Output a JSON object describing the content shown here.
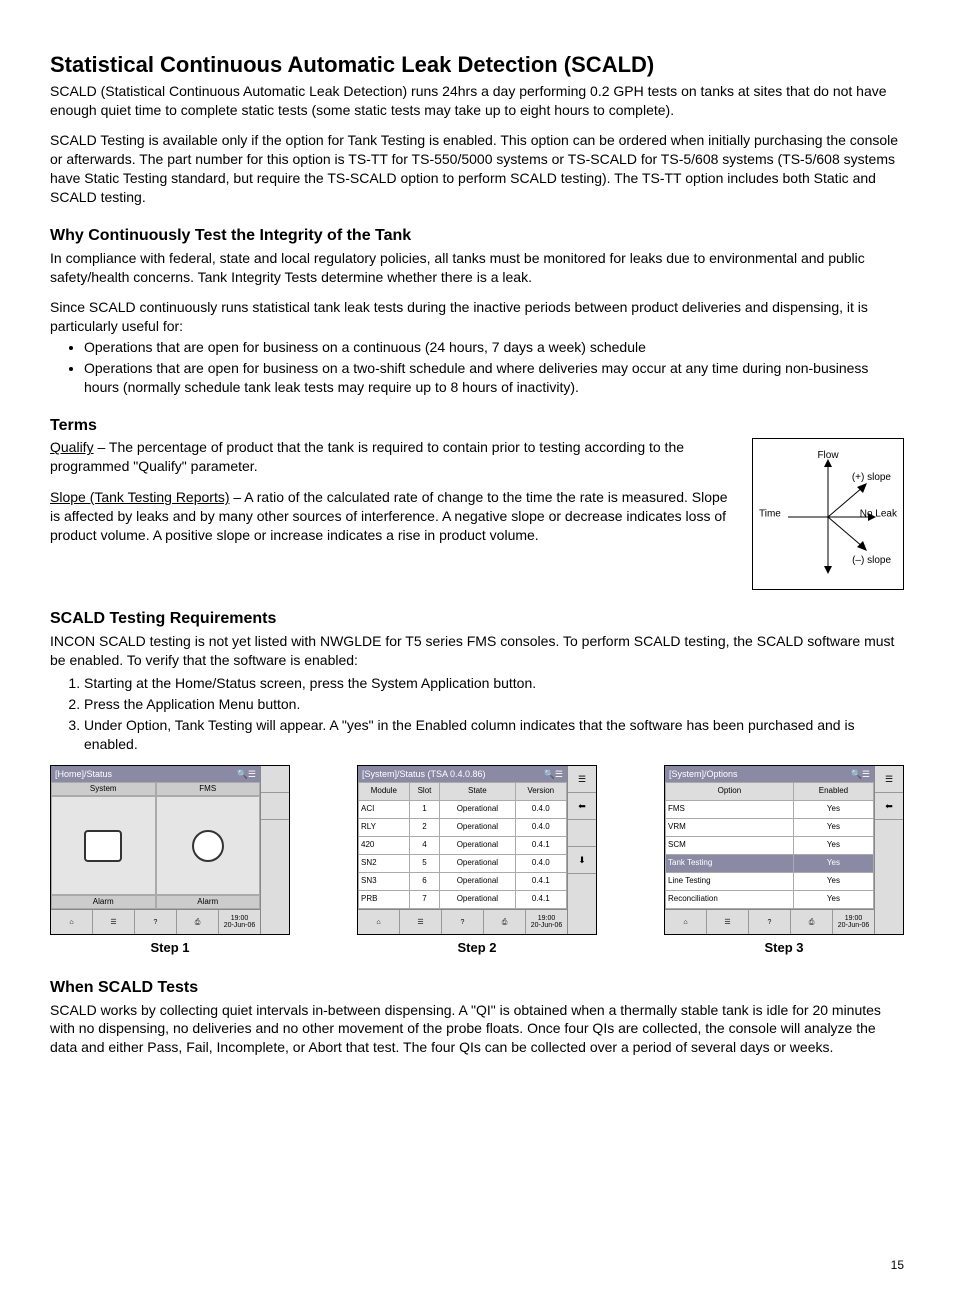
{
  "title": "Statistical Continuous Automatic Leak Detection (SCALD)",
  "intro1": "SCALD (Statistical Continuous Automatic Leak Detection) runs 24hrs a day performing 0.2 GPH tests on tanks at sites that do not have enough quiet time to complete static tests (some static tests may take up to eight hours to complete).",
  "intro2": "SCALD Testing is available only if the option for Tank Testing is enabled. This option can be ordered when initially purchasing the console or afterwards. The part number for this option is TS-TT for TS-550/5000 systems or TS-SCALD for TS-5/608 systems (TS-5/608 systems have Static Testing standard, but require the TS-SCALD option to perform SCALD testing). The TS-TT option includes both Static and SCALD testing.",
  "why_h": "Why Continuously Test the Integrity of the Tank",
  "why_p1": "In compliance with federal, state and local regulatory policies, all tanks must be monitored for leaks due to environmental and public safety/health concerns. Tank Integrity Tests determine whether there is a leak.",
  "why_p2": "Since SCALD continuously runs statistical tank leak tests during the inactive periods between product deliveries and dispensing, it is particularly useful for:",
  "why_li1": "Operations that are open for business on a continuous (24 hours, 7 days a week) schedule",
  "why_li2": "Operations that are open for business on a two-shift schedule and where deliveries may occur at any time during non-business hours (normally schedule tank leak tests may require up to 8 hours of inactivity).",
  "terms_h": "Terms",
  "terms_qualify_t": "Qualify",
  "terms_qualify_d": " – The percentage of product that the tank is required to contain prior to testing according to the programmed \"Qualify\" parameter.",
  "terms_slope_t": "Slope (Tank Testing Reports)",
  "terms_slope_d": " – A ratio of the calculated rate of change to the time the rate is measured. Slope is affected by leaks and by many other sources of interference. A negative slope or decrease indicates loss of product volume. A positive slope or increase indicates a rise in product volume.",
  "diagram": {
    "flow": "Flow",
    "time": "Time",
    "noleak": "No Leak",
    "plus": "(+) slope",
    "minus": "(–) slope"
  },
  "req_h": "SCALD Testing Requirements",
  "req_p": "INCON SCALD testing is not yet listed with NWGLDE for T5 series FMS consoles. To perform SCALD testing, the SCALD software must be enabled. To verify that the software is enabled:",
  "req_li1": "Starting at the Home/Status screen, press the System Application button.",
  "req_li2": "Press the Application Menu button.",
  "req_li3": "Under Option, Tank Testing will appear.  A \"yes\" in the Enabled column indicates that the software has been purchased and is enabled.",
  "step_labels": {
    "s1": "Step 1",
    "s2": "Step 2",
    "s3": "Step 3"
  },
  "screen1": {
    "title": "[Home]/Status",
    "system": "System",
    "fms": "FMS",
    "alarm1": "Alarm",
    "alarm2": "Alarm",
    "time": "19:00",
    "date": "20-Jun-06"
  },
  "screen2": {
    "title": "[System]/Status (TSA 0.4.0.86)",
    "cols": [
      "Module",
      "Slot",
      "State",
      "Version"
    ],
    "rows": [
      [
        "ACI",
        "1",
        "Operational",
        "0.4.0"
      ],
      [
        "RLY",
        "2",
        "Operational",
        "0.4.0"
      ],
      [
        "420",
        "4",
        "Operational",
        "0.4.1"
      ],
      [
        "SN2",
        "5",
        "Operational",
        "0.4.0"
      ],
      [
        "SN3",
        "6",
        "Operational",
        "0.4.1"
      ],
      [
        "PRB",
        "7",
        "Operational",
        "0.4.1"
      ]
    ],
    "time": "19:00",
    "date": "20-Jun-06"
  },
  "screen3": {
    "title": "[System]/Options",
    "cols": [
      "Option",
      "Enabled"
    ],
    "rows": [
      [
        "FMS",
        "Yes"
      ],
      [
        "VRM",
        "Yes"
      ],
      [
        "SCM",
        "Yes"
      ],
      [
        "Tank Testing",
        "Yes"
      ],
      [
        "Line Testing",
        "Yes"
      ],
      [
        "Reconciliation",
        "Yes"
      ]
    ],
    "highlight": 3,
    "time": "19:00",
    "date": "20-Jun-06"
  },
  "when_h": "When SCALD Tests",
  "when_p": "SCALD works by collecting quiet intervals in-between dispensing. A \"QI\" is obtained when a thermally stable tank is idle for 20 minutes with no dispensing, no deliveries and no other movement of the probe floats. Once four QIs are collected, the console will analyze the data and either Pass, Fail, Incomplete, or Abort that test. The four QIs can be collected over a period of several days or weeks.",
  "page_num": "15"
}
